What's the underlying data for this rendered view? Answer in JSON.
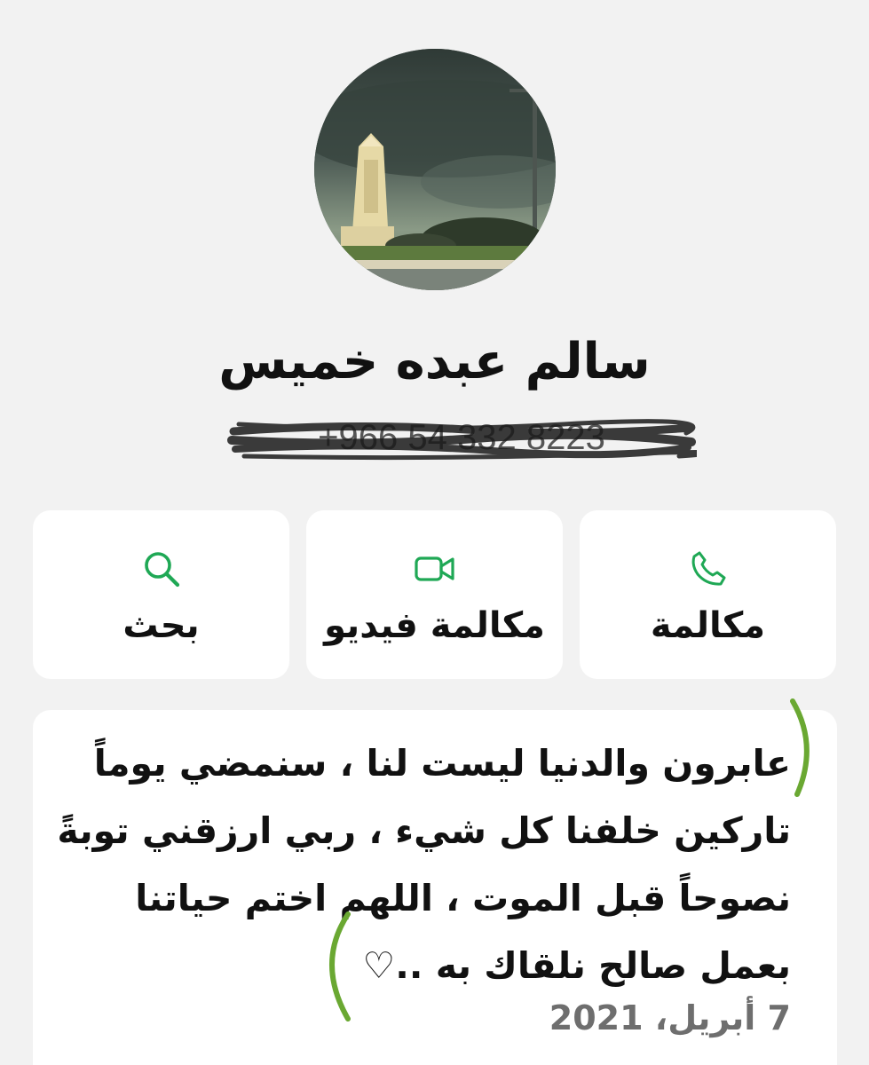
{
  "contact": {
    "name": "سالم عبده خميس",
    "phone": "+966 54 332 8223"
  },
  "actions": [
    {
      "label": "مكالمة",
      "icon": "phone-icon"
    },
    {
      "label": "مكالمة فيديو",
      "icon": "video-camera-icon"
    },
    {
      "label": "بحث",
      "icon": "search-icon"
    }
  ],
  "about": {
    "text": "عابرون والدنيا ليست لنا ، سنمضي يوماً\nتاركين خلفنا كل شيء ، ربي ارزقني توبةً\nنصوحاً قبل الموت ، اللهم اختم حياتنا\nبعمل صالح نلقاك به ..♡",
    "date": "7 أبريل، 2021"
  },
  "colors": {
    "background": "#f2f2f2",
    "card": "#ffffff",
    "accent": "#1fa855",
    "annotation": "#6aa832"
  }
}
